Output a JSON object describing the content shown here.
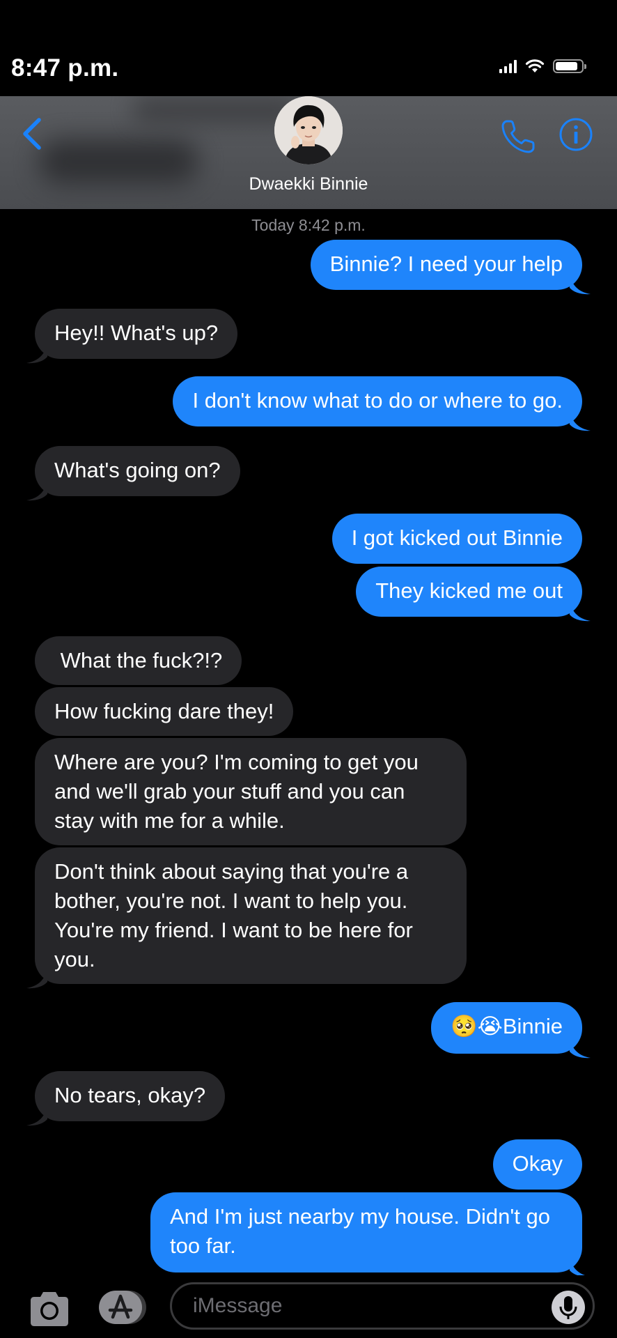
{
  "status_bar": {
    "time": "8:47 p.m.",
    "icons": [
      "signal-icon",
      "wifi-icon",
      "battery-icon"
    ],
    "battery_level": 0.85
  },
  "header": {
    "back_icon": "chevron-left-icon",
    "contact_name": "Dwaekki Binnie",
    "call_icon": "phone-icon",
    "info_icon": "info-icon"
  },
  "conversation": {
    "timestamp": "Today 8:42 p.m.",
    "messages": [
      {
        "from": "me",
        "text": "Binnie? I need your help"
      },
      {
        "from": "them",
        "text": "Hey!! What's up?"
      },
      {
        "from": "me",
        "text": "I don't know what to do or where to go."
      },
      {
        "from": "them",
        "text": "What's going on?"
      },
      {
        "from": "me",
        "text": "I got kicked out Binnie"
      },
      {
        "from": "me",
        "text": "They kicked me out"
      },
      {
        "from": "them",
        "text": " What the fuck?!?"
      },
      {
        "from": "them",
        "text": "How fucking dare they!"
      },
      {
        "from": "them",
        "text": "Where are you? I'm coming to get you and we'll grab your stuff and you can stay with me for a while."
      },
      {
        "from": "them",
        "text": "Don't think about saying that you're a bother, you're not. I want to help you. You're my friend. I want to be here for you."
      },
      {
        "from": "me",
        "text": "🥺😭Binnie"
      },
      {
        "from": "them",
        "text": "No tears, okay?"
      },
      {
        "from": "me",
        "text": "Okay"
      },
      {
        "from": "me",
        "text": "And I'm just nearby my house. Didn't go too far."
      }
    ]
  },
  "input_bar": {
    "camera_icon": "camera-icon",
    "apps_icon": "app-store-icon",
    "placeholder": "iMessage",
    "mic_icon": "microphone-icon"
  },
  "colors": {
    "outgoing_bubble": "#1f85fb",
    "incoming_bubble": "#262629",
    "accent": "#1a82fb",
    "background": "#000000"
  }
}
